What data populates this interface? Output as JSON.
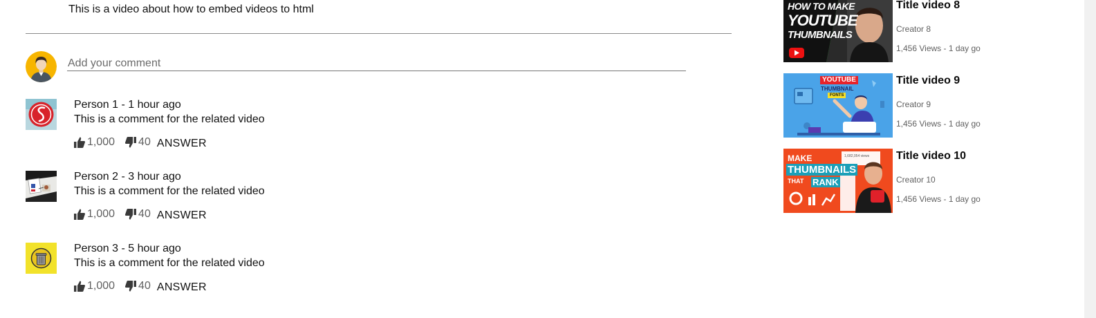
{
  "video": {
    "description": "This is a video about how to embed videos to html"
  },
  "comment_box": {
    "placeholder": "Add your comment"
  },
  "comments": [
    {
      "header": "Person 1 - 1 hour ago",
      "text": "This is a comment for the related video",
      "likes": "1,000",
      "dislikes": "40",
      "answer_label": "ANSWER",
      "avatar_icon": "logo-avatar-icon"
    },
    {
      "header": "Person 2 - 3 hour ago",
      "text": "This is a comment for the related video",
      "likes": "1,000",
      "dislikes": "40",
      "answer_label": "ANSWER",
      "avatar_icon": "photo-avatar-icon"
    },
    {
      "header": "Person 3 - 5 hour ago",
      "text": "This is a comment for the related video",
      "likes": "1,000",
      "dislikes": "40",
      "answer_label": "ANSWER",
      "avatar_icon": "trash-logo-avatar-icon"
    }
  ],
  "related_videos": [
    {
      "title": "Title video 8",
      "creator": "Creator 8",
      "meta": "1,456 Views - 1 day go",
      "thumbnail_text": [
        "HOW TO MAKE",
        "YOUTUBE",
        "THUMBNAILS"
      ]
    },
    {
      "title": "Title video 9",
      "creator": "Creator 9",
      "meta": "1,456 Views - 1 day go",
      "thumbnail_text": [
        "YOUTUBE",
        "THUMBNAIL",
        "FONTS"
      ]
    },
    {
      "title": "Title video 10",
      "creator": "Creator 10",
      "meta": "1,456 Views - 1 day go",
      "thumbnail_text": [
        "MAKE",
        "THUMBNAILS",
        "THAT",
        "RANK",
        "1,682,054 views"
      ]
    }
  ],
  "colors": {
    "avatar_yellow": "#f7b500",
    "thumb8_green": "#1ec02a",
    "thumb9_blue": "#4aa3e8",
    "thumb10_orange": "#f04a1e"
  }
}
